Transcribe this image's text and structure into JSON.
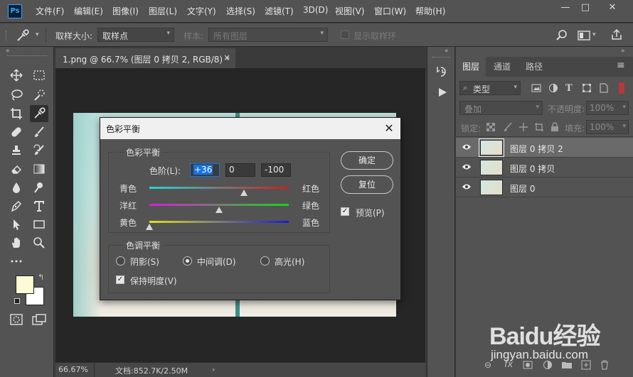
{
  "app": {
    "logo": "Ps"
  },
  "menu": [
    "文件(F)",
    "编辑(E)",
    "图像(I)",
    "图层(L)",
    "文字(Y)",
    "选择(S)",
    "滤镜(T)",
    "3D(D)",
    "视图(V)",
    "窗口(W)",
    "帮助(H)"
  ],
  "window_controls": {
    "minimize": "—",
    "restore": "□",
    "close": "✕"
  },
  "options_bar": {
    "sample_size_label": "取样大小:",
    "sample_size_value": "取样点",
    "sample_label": "样本:",
    "sample_value": "所有图层",
    "show_ring_label": "显示取样环"
  },
  "document": {
    "tab_title": "1.png @ 66.7% (图层 0 拷贝 2, RGB/8) *",
    "tab_close": "×",
    "zoom": "66.67%",
    "doc_info": "文档:852.7K/2.50M",
    "status_arrow": "›"
  },
  "layers_panel": {
    "tabs": [
      "图层",
      "通道",
      "路径"
    ],
    "active_tab": "图层",
    "filter_label": "类型",
    "blend_mode": "叠加",
    "opacity_label": "不透明度:",
    "opacity_value": "100%",
    "lock_label": "锁定:",
    "fill_label": "填充:",
    "fill_value": "100%",
    "layers": [
      {
        "name": "图层 0 拷贝 2",
        "selected": true
      },
      {
        "name": "图层 0 拷贝",
        "selected": false
      },
      {
        "name": "图层 0",
        "selected": false
      }
    ]
  },
  "dialog": {
    "title": "色彩平衡",
    "close": "✕",
    "color_balance_group": "色彩平衡",
    "levels_label": "色阶(L):",
    "levels": [
      "+36",
      "0",
      "-100"
    ],
    "sliders": [
      {
        "left": "青色",
        "right": "红色",
        "value": 36
      },
      {
        "left": "洋红",
        "right": "绿色",
        "value": 0
      },
      {
        "left": "黄色",
        "right": "蓝色",
        "value": -100
      }
    ],
    "tone_group": "色调平衡",
    "tones": [
      "阴影(S)",
      "中间调(D)",
      "高光(H)"
    ],
    "selected_tone": "中间调(D)",
    "preserve_luminosity": "保持明度(V)",
    "ok_button": "确定",
    "reset_button": "复位",
    "preview_label": "预览(P)"
  },
  "watermark": {
    "brand": "Baidu经验",
    "url": "jingyan.baidu.com"
  },
  "colors": {
    "ui_bg": "#535353",
    "canvas_bg": "#262626",
    "selection_blue": "#1473e6",
    "foreground_swatch": "#fdfad7",
    "background_swatch": "#ffffff"
  }
}
